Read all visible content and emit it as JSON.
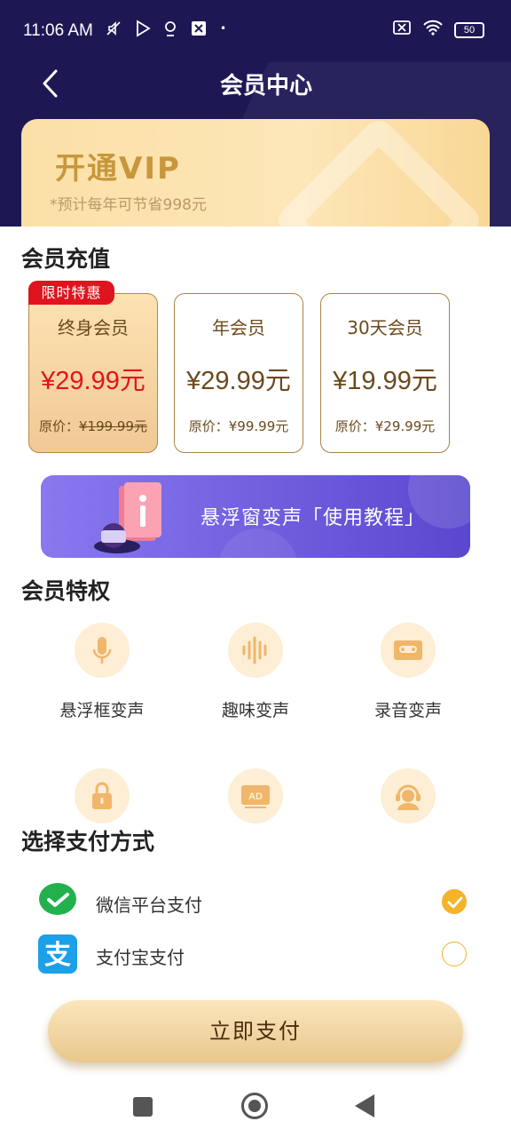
{
  "status_bar": {
    "time": "11:06 AM",
    "battery": "50"
  },
  "header": {
    "title": "会员中心",
    "vip_title": "开通VIP",
    "vip_subtitle": "*预计每年可节省998元"
  },
  "recharge": {
    "title": "会员充值",
    "promo_badge": "限时特惠",
    "plans": [
      {
        "name": "终身会员",
        "price": "¥29.99元",
        "orig_label": "原价：",
        "orig_value": "¥199.99元",
        "selected": true
      },
      {
        "name": "年会员",
        "price": "¥29.99元",
        "orig_label": "原价：",
        "orig_value": "¥99.99元",
        "selected": false
      },
      {
        "name": "30天会员",
        "price": "¥19.99元",
        "orig_label": "原价：",
        "orig_value": "¥29.99元",
        "selected": false
      }
    ]
  },
  "tutorial_banner": {
    "text": "悬浮窗变声「使用教程」"
  },
  "privileges": {
    "title": "会员特权",
    "items": [
      {
        "label": "悬浮框变声",
        "icon": "microphone-icon"
      },
      {
        "label": "趣味变声",
        "icon": "sound-wave-icon"
      },
      {
        "label": "录音变声",
        "icon": "cassette-icon"
      },
      {
        "label": "",
        "icon": "lock-icon"
      },
      {
        "label": "",
        "icon": "ad-icon"
      },
      {
        "label": "",
        "icon": "customer-service-icon"
      }
    ]
  },
  "payment": {
    "title": "选择支付方式",
    "methods": [
      {
        "label": "微信平台支付",
        "icon": "wechat-pay-icon",
        "checked": true
      },
      {
        "label": "支付宝支付",
        "icon": "alipay-icon",
        "checked": false
      }
    ],
    "pay_button": "立即支付"
  },
  "colors": {
    "header_bg": "#1d1854",
    "accent_gold": "#f5b32a",
    "price_red": "#e3141a",
    "banner_purple": "#6d5bdc"
  }
}
